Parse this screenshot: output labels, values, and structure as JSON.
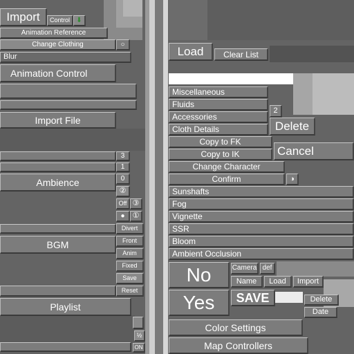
{
  "left": {
    "import": "Import",
    "control": "Control",
    "animation_reference": "Animation Reference",
    "change_clothing": "Change Clothing",
    "blur": "Blur",
    "animation_control": "Animation Control",
    "import_file": "Import File",
    "ambience": "Ambience",
    "bgm": "BGM",
    "playlist": "Playlist",
    "num_3": "3",
    "num_1": "1",
    "num_0": "0",
    "circ_2": "②",
    "off": "Off",
    "circ_3": "③",
    "circ_1": "①",
    "divert": "Divert",
    "front": "Front",
    "anim": "Anim",
    "fixed": "Fixed",
    "save": "Save",
    "reset": "Reset",
    "half": "½",
    "on": "ON"
  },
  "right": {
    "load": "Load",
    "clear_list": "Clear List",
    "miscellaneous": "Miscellaneous",
    "fluids": "Fluids",
    "accessories": "Accessories",
    "cloth_details": "Cloth Details",
    "num_2": "2",
    "delete_big": "Delete",
    "copy_fk": "Copy to FK",
    "copy_ik": "Copy to IK",
    "cancel": "Cancel",
    "change_character": "Change Character",
    "confirm": "Confirm",
    "sunshafts": "Sunshafts",
    "fog": "Fog",
    "vignette": "Vignette",
    "ssr": "SSR",
    "bloom": "Bloom",
    "ambient_occlusion": "Ambient Occlusion",
    "no": "No",
    "yes": "Yes",
    "camera": "Camera",
    "def": "def",
    "name": "Name",
    "load_small": "Load",
    "import_small": "Import",
    "save_big": "SAVE",
    "delete_small": "Delete",
    "date": "Date",
    "color_settings": "Color Settings",
    "map_controllers": "Map Controllers"
  }
}
